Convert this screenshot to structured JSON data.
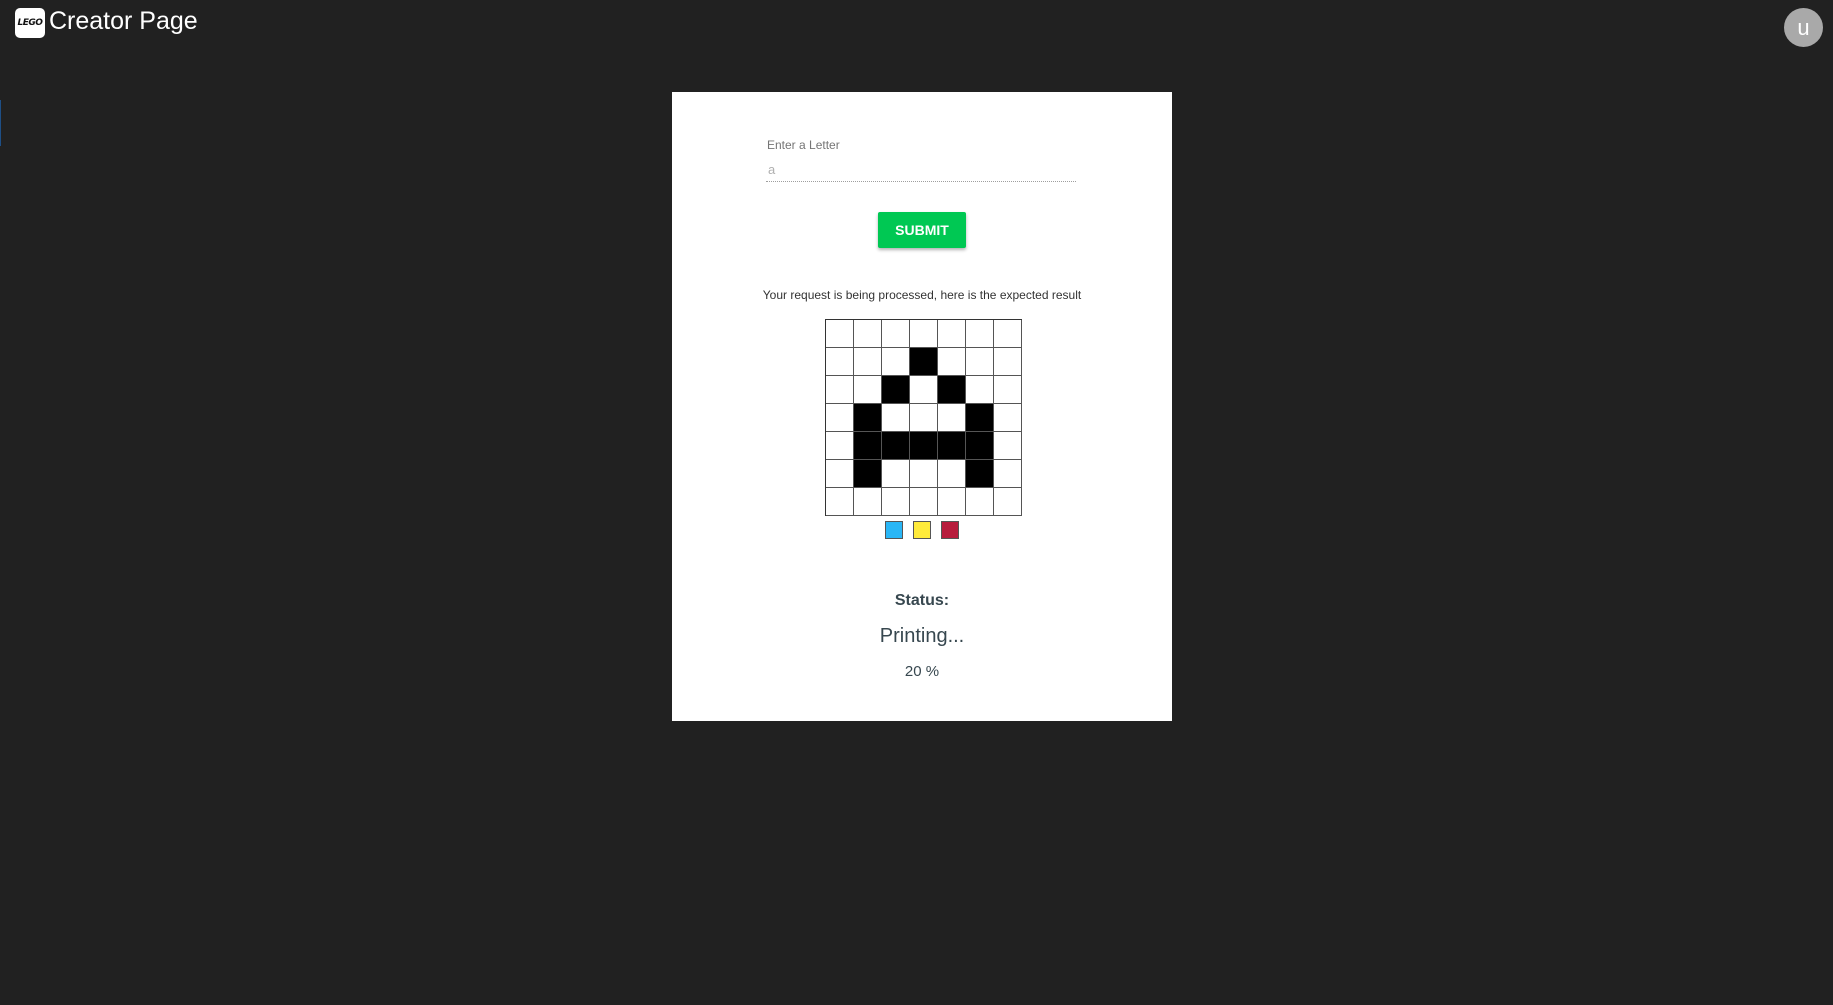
{
  "header": {
    "logo_text": "LEGO",
    "title": "Creator Page",
    "avatar_initial": "u"
  },
  "form": {
    "label": "Enter a Letter",
    "input_placeholder": "a",
    "input_value": "",
    "submit_label": "SUBMIT"
  },
  "result": {
    "message": "Your request is being processed, here is the expected result",
    "grid": [
      [
        0,
        0,
        0,
        0,
        0,
        0,
        0
      ],
      [
        0,
        0,
        0,
        1,
        0,
        0,
        0
      ],
      [
        0,
        0,
        1,
        0,
        1,
        0,
        0
      ],
      [
        0,
        1,
        0,
        0,
        0,
        1,
        0
      ],
      [
        0,
        1,
        1,
        1,
        1,
        1,
        0
      ],
      [
        0,
        1,
        0,
        0,
        0,
        1,
        0
      ],
      [
        0,
        0,
        0,
        0,
        0,
        0,
        0
      ]
    ],
    "swatches": [
      {
        "name": "blue",
        "color": "#29b6f6"
      },
      {
        "name": "yellow",
        "color": "#ffeb3b"
      },
      {
        "name": "crimson",
        "color": "#b71c3c"
      }
    ]
  },
  "status": {
    "label": "Status:",
    "value": "Printing...",
    "progress_text": "20 %",
    "progress": 20
  }
}
